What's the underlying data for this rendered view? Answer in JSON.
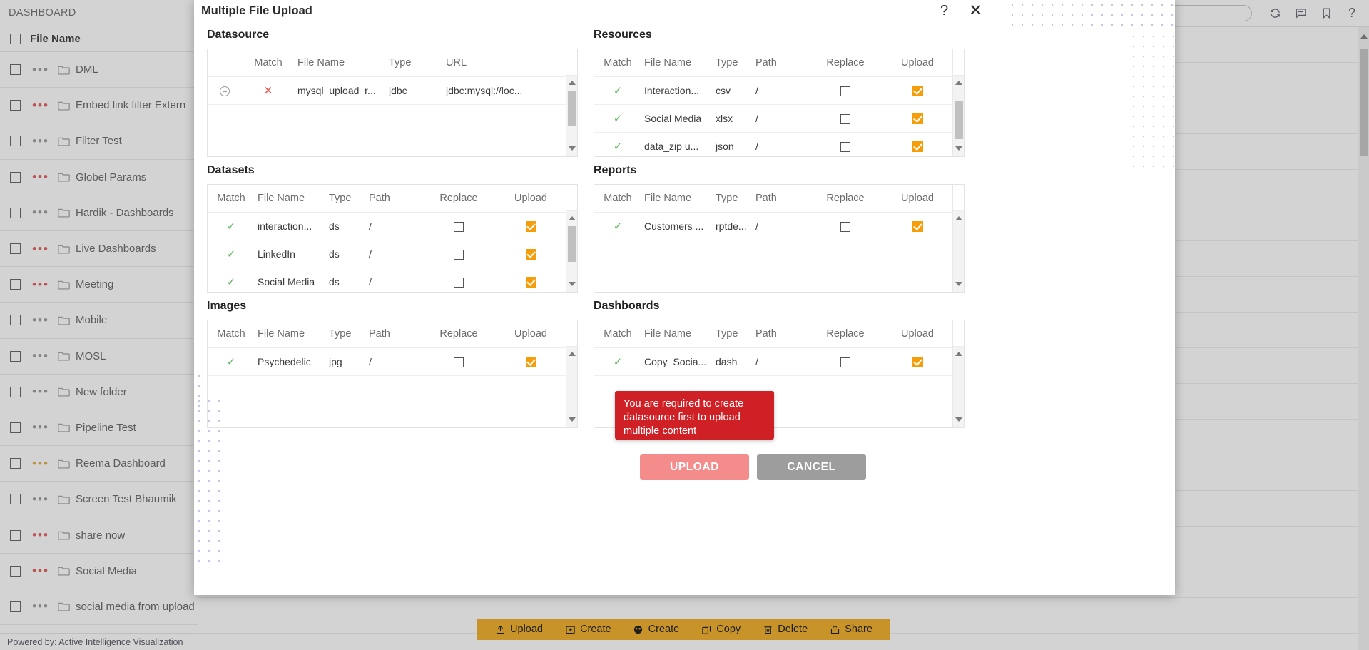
{
  "background": {
    "breadcrumb": "DASHBOARD",
    "list_header": "File Name",
    "footer": "Powered by: Active Intelligence Visualization",
    "folders": [
      {
        "name": "DML",
        "dots_color": "#8a8a8a"
      },
      {
        "name": "Embed link filter Extern",
        "dots_color": "#e03b3b"
      },
      {
        "name": "Filter Test",
        "dots_color": "#8a8a8a"
      },
      {
        "name": "Globel Params",
        "dots_color": "#e03b3b"
      },
      {
        "name": "Hardik - Dashboards",
        "dots_color": "#8a8a8a"
      },
      {
        "name": "Live Dashboards",
        "dots_color": "#e03b3b"
      },
      {
        "name": "Meeting",
        "dots_color": "#e03b3b"
      },
      {
        "name": "Mobile",
        "dots_color": "#8a8a8a"
      },
      {
        "name": "MOSL",
        "dots_color": "#8a8a8a"
      },
      {
        "name": "New folder",
        "dots_color": "#8a8a8a"
      },
      {
        "name": "Pipeline Test",
        "dots_color": "#8a8a8a"
      },
      {
        "name": "Reema Dashboard",
        "dots_color": "#e09b23"
      },
      {
        "name": "Screen Test Bhaumik",
        "dots_color": "#8a8a8a"
      },
      {
        "name": "share now",
        "dots_color": "#e03b3b"
      },
      {
        "name": "Social Media",
        "dots_color": "#e03b3b"
      },
      {
        "name": "social media from upload",
        "dots_color": "#8a8a8a"
      }
    ],
    "topbar_icons": [
      "refresh-icon",
      "comment-icon",
      "bookmark-icon",
      "help-icon"
    ],
    "search_placeholder": "",
    "action_bar": [
      {
        "label": "Upload",
        "icon": "upload-icon"
      },
      {
        "label": "Create",
        "icon": "create-folder-icon"
      },
      {
        "label": "Create",
        "icon": "create-dashboard-icon"
      },
      {
        "label": "Copy",
        "icon": "copy-icon"
      },
      {
        "label": "Delete",
        "icon": "trash-icon"
      },
      {
        "label": "Share",
        "icon": "share-icon"
      }
    ],
    "action_bar_color": "#c8942a"
  },
  "modal": {
    "title": "Multiple File Upload",
    "help_glyph": "?",
    "close_glyph": "✕",
    "tooltip": "You are required to create datasource first to upload multiple content",
    "tooltip_color": "#cf2026",
    "buttons": {
      "upload": "UPLOAD",
      "cancel": "CANCEL",
      "upload_color": "#f58c8c",
      "cancel_color": "#9d9d9d"
    },
    "sections": [
      {
        "id": "datasource",
        "title": "Datasource",
        "columns": [
          "",
          "Match",
          "File Name",
          "Type",
          "URL"
        ],
        "rows": [
          {
            "expand": "plus-circle-icon",
            "match": "x",
            "file_name": "mysql_upload_r...",
            "type": "jdbc",
            "url": "jdbc:mysql://loc..."
          }
        ]
      },
      {
        "id": "resources",
        "title": "Resources",
        "columns": [
          "Match",
          "File Name",
          "Type",
          "Path",
          "Replace",
          "Upload"
        ],
        "rows": [
          {
            "match": "check",
            "file_name": "Interaction...",
            "type": "csv",
            "path": "/",
            "replace": false,
            "upload": true
          },
          {
            "match": "check",
            "file_name": "Social Media",
            "type": "xlsx",
            "path": "/",
            "replace": false,
            "upload": true
          },
          {
            "match": "check",
            "file_name": "data_zip u...",
            "type": "json",
            "path": "/",
            "replace": false,
            "upload": true
          }
        ]
      },
      {
        "id": "datasets",
        "title": "Datasets",
        "columns": [
          "Match",
          "File Name",
          "Type",
          "Path",
          "Replace",
          "Upload"
        ],
        "rows": [
          {
            "match": "check",
            "file_name": "interaction...",
            "type": "ds",
            "path": "/",
            "replace": false,
            "upload": true
          },
          {
            "match": "check",
            "file_name": "LinkedIn",
            "type": "ds",
            "path": "/",
            "replace": false,
            "upload": true
          },
          {
            "match": "check",
            "file_name": "Social Media",
            "type": "ds",
            "path": "/",
            "replace": false,
            "upload": true
          }
        ]
      },
      {
        "id": "reports",
        "title": "Reports",
        "columns": [
          "Match",
          "File Name",
          "Type",
          "Path",
          "Replace",
          "Upload"
        ],
        "rows": [
          {
            "match": "check",
            "file_name": "Customers ...",
            "type": "rptde...",
            "path": "/",
            "replace": false,
            "upload": true
          }
        ]
      },
      {
        "id": "images",
        "title": "Images",
        "columns": [
          "Match",
          "File Name",
          "Type",
          "Path",
          "Replace",
          "Upload"
        ],
        "rows": [
          {
            "match": "check",
            "file_name": "Psychedelic",
            "type": "jpg",
            "path": "/",
            "replace": false,
            "upload": true
          }
        ]
      },
      {
        "id": "dashboards",
        "title": "Dashboards",
        "columns": [
          "Match",
          "File Name",
          "Type",
          "Path",
          "Replace",
          "Upload"
        ],
        "rows": [
          {
            "match": "check",
            "file_name": "Copy_Socia...",
            "type": "dash",
            "path": "/",
            "replace": false,
            "upload": true
          }
        ]
      }
    ]
  }
}
